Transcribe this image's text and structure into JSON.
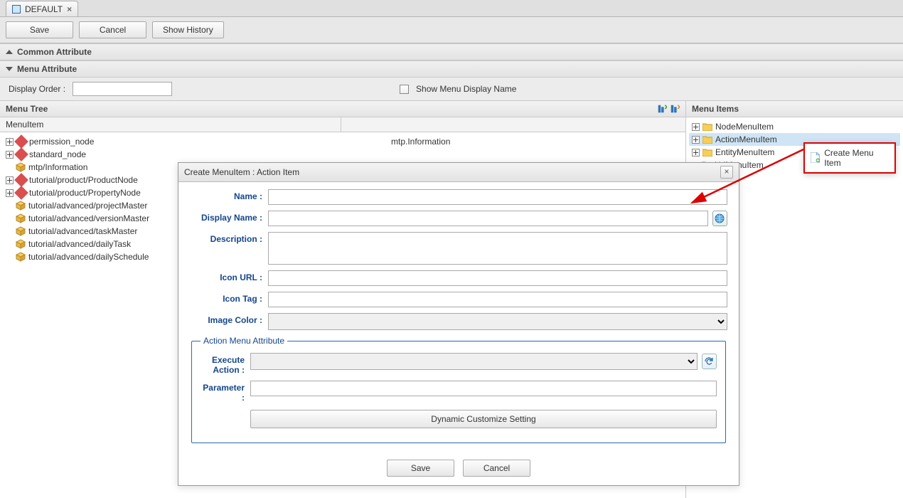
{
  "tab": {
    "label": "DEFAULT"
  },
  "toolbar": {
    "save": "Save",
    "cancel": "Cancel",
    "history": "Show History"
  },
  "sections": {
    "common": "Common Attribute",
    "menu_attr": "Menu Attribute"
  },
  "menu_attr": {
    "display_order_label": "Display Order :",
    "display_order_value": "",
    "show_display_name_label": "Show Menu Display Name"
  },
  "left_panel": {
    "title": "Menu Tree",
    "col_a": "MenuItem"
  },
  "tree": {
    "items": [
      {
        "label": "permission_node"
      },
      {
        "label": "standard_node"
      },
      {
        "label": "mtp/Information"
      },
      {
        "label": "tutorial/product/ProductNode"
      },
      {
        "label": "tutorial/product/PropertyNode"
      },
      {
        "label": "tutorial/advanced/projectMaster"
      },
      {
        "label": "tutorial/advanced/versionMaster"
      },
      {
        "label": "tutorial/advanced/taskMaster"
      },
      {
        "label": "tutorial/advanced/dailyTask"
      },
      {
        "label": "tutorial/advanced/dailySchedule"
      }
    ],
    "detail_title": "mtp.Information"
  },
  "dialog": {
    "title": "Create MenuItem : Action Item",
    "fields": {
      "name": "Name :",
      "display_name": "Display Name :",
      "description": "Description :",
      "icon_url": "Icon URL :",
      "icon_tag": "Icon Tag :",
      "image_color": "Image Color :"
    },
    "action_group": "Action Menu Attribute",
    "execute_action": "Execute Action :",
    "parameter": "Parameter :",
    "dynamic_btn": "Dynamic Customize Setting",
    "save": "Save",
    "cancel": "Cancel"
  },
  "right_panel": {
    "title": "Menu Items",
    "items": [
      {
        "label": "NodeMenuItem"
      },
      {
        "label": "ActionMenuItem"
      },
      {
        "label": "EntityMenuItem"
      },
      {
        "label": "UrlMenuItem"
      }
    ]
  },
  "context": {
    "create": "Create Menu Item"
  }
}
